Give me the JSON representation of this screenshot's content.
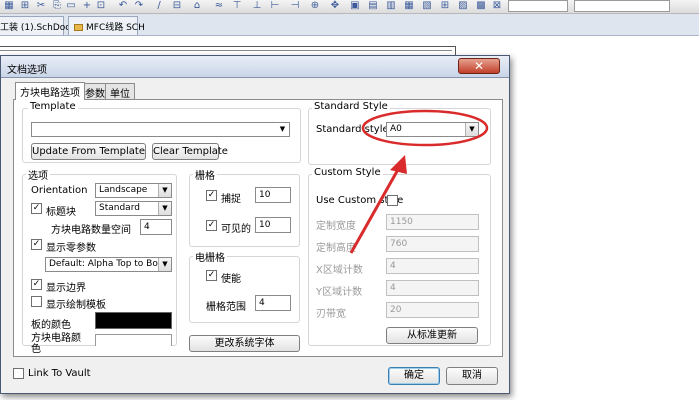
{
  "background": {
    "doc_tabs": [
      {
        "label": "工装 (1).SchDoc"
      },
      {
        "label": "MFC线路 SCH"
      }
    ]
  },
  "dialog": {
    "title": "文档选项",
    "close_glyph": "✕",
    "tabs": [
      {
        "label": "方块电路选项"
      },
      {
        "label": "参数"
      },
      {
        "label": "单位"
      }
    ],
    "template": {
      "group_label": "Template",
      "value": "",
      "update_button": "Update From Template",
      "clear_button": "Clear Template"
    },
    "options": {
      "group_label": "选项",
      "orientation_label": "Orientation",
      "orientation_value": "Landscape",
      "title_block_label": "标题块",
      "title_block_checked": true,
      "title_block_value": "Standard",
      "sheet_number_label": "方块电路数量空间",
      "sheet_number_value": "4",
      "show_reference_label": "显示零参数",
      "show_reference_checked": true,
      "alpha_value": "Default: Alpha Top to Bottom,",
      "show_border_label": "显示边界",
      "show_border_checked": true,
      "show_template_label": "显示绘制模板",
      "show_template_checked": false,
      "border_color_label": "板的颜色",
      "border_color": "#000000",
      "sheet_color_label": "方块电路颜色",
      "sheet_color": "#ffffff"
    },
    "grid": {
      "group_label": "栅格",
      "snap_label": "捕捉",
      "snap_checked": true,
      "snap_value": "10",
      "visible_label": "可见的",
      "visible_checked": true,
      "visible_value": "10"
    },
    "electrical_grid": {
      "group_label": "电栅格",
      "enable_label": "使能",
      "enable_checked": true,
      "range_label": "栅格范围",
      "range_value": "4"
    },
    "change_font_button": "更改系统字体",
    "standard_style": {
      "group_label": "Standard Style",
      "styles_label": "Standard styles",
      "styles_value": "A0"
    },
    "custom_style": {
      "group_label": "Custom Style",
      "use_custom_label": "Use Custom style",
      "use_custom_checked": false,
      "width_label": "定制宽度",
      "width_value": "1150",
      "height_label": "定制高度",
      "height_value": "760",
      "x_zones_label": "X区域计数",
      "x_zones_value": "4",
      "y_zones_label": "Y区域计数",
      "y_zones_value": "4",
      "margin_label": "刃带宽",
      "margin_value": "20",
      "update_standard_button": "从标准更新"
    },
    "link_to_vault_label": "Link To Vault",
    "link_to_vault_checked": false,
    "ok_button": "确定",
    "cancel_button": "取消"
  },
  "colors": {
    "annotation": "#d92b2b",
    "title_gradient_top": "#e9eef7"
  },
  "check_glyph": "✓",
  "combo_arrow_glyph": "▼"
}
